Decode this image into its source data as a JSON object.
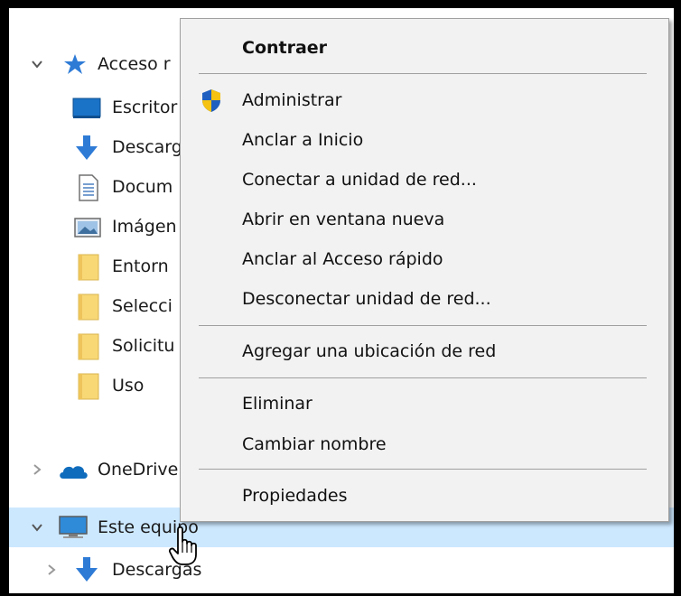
{
  "tree": {
    "items": [
      {
        "label": "Acceso r",
        "icon": "star-icon",
        "chevron": "expanded"
      },
      {
        "label": "Escritor",
        "icon": "desktop-icon"
      },
      {
        "label": "Descarg",
        "icon": "download-arrow-icon"
      },
      {
        "label": "Docum",
        "icon": "document-icon"
      },
      {
        "label": "Imágen",
        "icon": "picture-icon"
      },
      {
        "label": "Entorn",
        "icon": "folder-icon"
      },
      {
        "label": "Selecci",
        "icon": "folder-icon"
      },
      {
        "label": "Solicitu",
        "icon": "folder-icon"
      },
      {
        "label": "Uso",
        "icon": "folder-icon"
      },
      {
        "label": "OneDrive",
        "icon": "cloud-icon",
        "chevron": "collapsed"
      },
      {
        "label": "Este equipo",
        "icon": "computer-icon",
        "chevron": "expanded",
        "selected": true
      },
      {
        "label": "Descargas",
        "icon": "download-arrow-icon",
        "chevron": "collapsed"
      }
    ]
  },
  "context_menu": {
    "items": [
      {
        "label": "Contraer"
      },
      {
        "label": "Administrar",
        "icon": "uac-shield-icon"
      },
      {
        "label": "Anclar a Inicio"
      },
      {
        "label": "Conectar a unidad de red..."
      },
      {
        "label": "Abrir en ventana nueva"
      },
      {
        "label": "Anclar al Acceso rápido"
      },
      {
        "label": "Desconectar unidad de red..."
      },
      {
        "label": "Agregar una ubicación de red"
      },
      {
        "label": "Eliminar"
      },
      {
        "label": "Cambiar nombre"
      },
      {
        "label": "Propiedades"
      }
    ]
  },
  "colors": {
    "selection": "#cce8ff",
    "menu_background": "#f2f2f2",
    "folder": "#f8d775",
    "arrow_blue": "#2e7bd6",
    "shield_blue": "#1f5fbf",
    "shield_yellow": "#f5c211"
  }
}
